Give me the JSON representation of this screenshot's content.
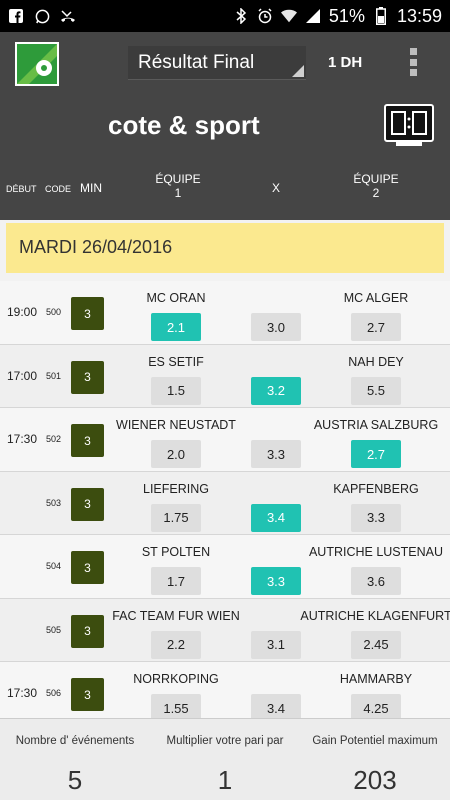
{
  "status": {
    "battery": "51%",
    "time": "13:59"
  },
  "header": {
    "dropdown": "Résultat Final",
    "currency": "1 DH",
    "brand": "cote & sport"
  },
  "columns": {
    "debut": "DÉBUT",
    "code": "CODE",
    "min": "MIN",
    "team1": "ÉQUIPE\n1",
    "x": "X",
    "team2": "ÉQUIPE\n2"
  },
  "date": "MARDI 26/04/2016",
  "matches": [
    {
      "time": "19:00",
      "code": "500",
      "min": "3",
      "team1": "MC ORAN",
      "team2": "MC ALGER",
      "odd1": "2.1",
      "oddx": "3.0",
      "odd2": "2.7",
      "selected": "1"
    },
    {
      "time": "17:00",
      "code": "501",
      "min": "3",
      "team1": "ES SETIF",
      "team2": "NAH DEY",
      "odd1": "1.5",
      "oddx": "3.2",
      "odd2": "5.5",
      "selected": "x"
    },
    {
      "time": "17:30",
      "code": "502",
      "min": "3",
      "team1": "WIENER NEUSTADT",
      "team2": "AUSTRIA SALZBURG",
      "odd1": "2.0",
      "oddx": "3.3",
      "odd2": "2.7",
      "selected": "2"
    },
    {
      "time": "",
      "code": "503",
      "min": "3",
      "team1": "LIEFERING",
      "team2": "KAPFENBERG",
      "odd1": "1.75",
      "oddx": "3.4",
      "odd2": "3.3",
      "selected": "x"
    },
    {
      "time": "",
      "code": "504",
      "min": "3",
      "team1": "ST POLTEN",
      "team2": "AUTRICHE LUSTENAU",
      "odd1": "1.7",
      "oddx": "3.3",
      "odd2": "3.6",
      "selected": "x"
    },
    {
      "time": "",
      "code": "505",
      "min": "3",
      "team1": "FAC TEAM FUR WIEN",
      "team2": "AUTRICHE KLAGENFURT",
      "odd1": "2.2",
      "oddx": "3.1",
      "odd2": "2.45",
      "selected": ""
    },
    {
      "time": "17:30",
      "code": "506",
      "min": "3",
      "team1": "NORRKOPING",
      "team2": "HAMMARBY",
      "odd1": "1.55",
      "oddx": "3.4",
      "odd2": "4.25",
      "selected": ""
    }
  ],
  "footer": {
    "events_label": "Nombre d' événements",
    "events_value": "5",
    "multiplier_label": "Multiplier votre pari par",
    "multiplier_value": "1",
    "gain_label": "Gain Potentiel maximum",
    "gain_value": "203"
  }
}
